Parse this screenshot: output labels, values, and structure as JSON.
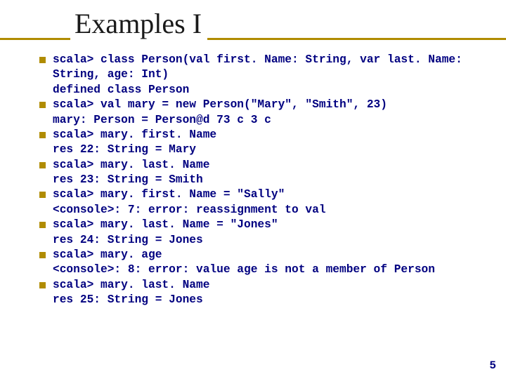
{
  "title": "Examples I",
  "items": [
    "scala> class Person(val first. Name: String, var last. Name: String, age: Int)\ndefined class Person",
    "scala> val mary = new Person(\"Mary\", \"Smith\", 23)\nmary: Person = Person@d 73 c 3 c",
    "scala> mary. first. Name\nres 22: String = Mary",
    "scala> mary. last. Name\nres 23: String = Smith",
    "scala> mary. first. Name = \"Sally\"\n<console>: 7: error: reassignment to val",
    "scala> mary. last. Name = \"Jones\"\nres 24: String = Jones",
    "scala> mary. age\n<console>: 8: error: value age is not a member of Person",
    "scala> mary. last. Name\nres 25: String = Jones"
  ],
  "page_number": "5"
}
